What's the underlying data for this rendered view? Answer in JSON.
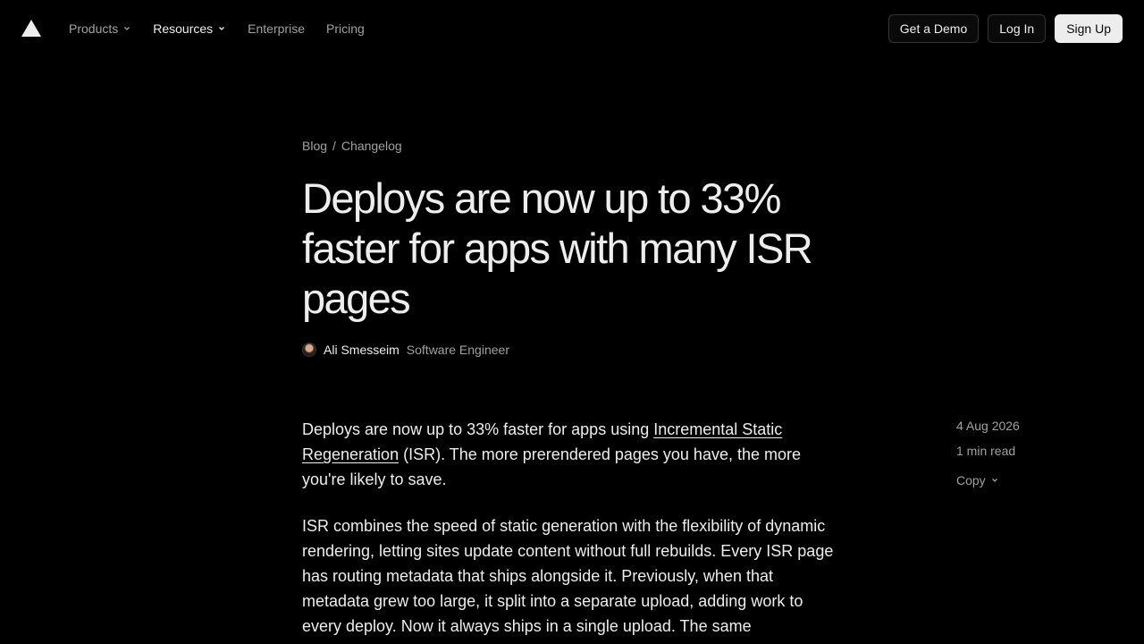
{
  "nav": {
    "logo_icon": "triangle-logo-icon",
    "links": [
      {
        "label": "Products",
        "dropdown": true,
        "active": false
      },
      {
        "label": "Resources",
        "dropdown": true,
        "active": true
      },
      {
        "label": "Enterprise",
        "dropdown": false,
        "active": false
      },
      {
        "label": "Pricing",
        "dropdown": false,
        "active": false
      }
    ],
    "demo_label": "Get a Demo",
    "login_label": "Log In",
    "signup_label": "Sign Up"
  },
  "breadcrumb": {
    "items": [
      "Blog",
      "Changelog"
    ],
    "separator": "/"
  },
  "article": {
    "title": "Deploys are now up to 33% faster for apps with many ISR pages",
    "author_name": "Ali Smesseim",
    "author_role": "Software Engineer",
    "p1_before": "Deploys are now up to 33% faster for apps using ",
    "p1_link": "Incremental Static Regeneration",
    "p1_after": " (ISR). The more prerendered pages you have, the more you're likely to save.",
    "p2": "ISR combines the speed of static generation with the flexibility of dynamic rendering, letting sites update content without full rebuilds. Every ISR page has routing metadata that ships alongside it. Previously, when that metadata grew too large, it split into a separate upload, adding work to every deploy. Now it always ships in a single upload. The same"
  },
  "meta": {
    "date": "4 Aug 2026",
    "read_time": "1 min read",
    "copy_label": "Copy"
  },
  "colors": {
    "background": "#000000",
    "text": "#ededed",
    "muted": "#a1a1a1",
    "border": "#333333"
  }
}
